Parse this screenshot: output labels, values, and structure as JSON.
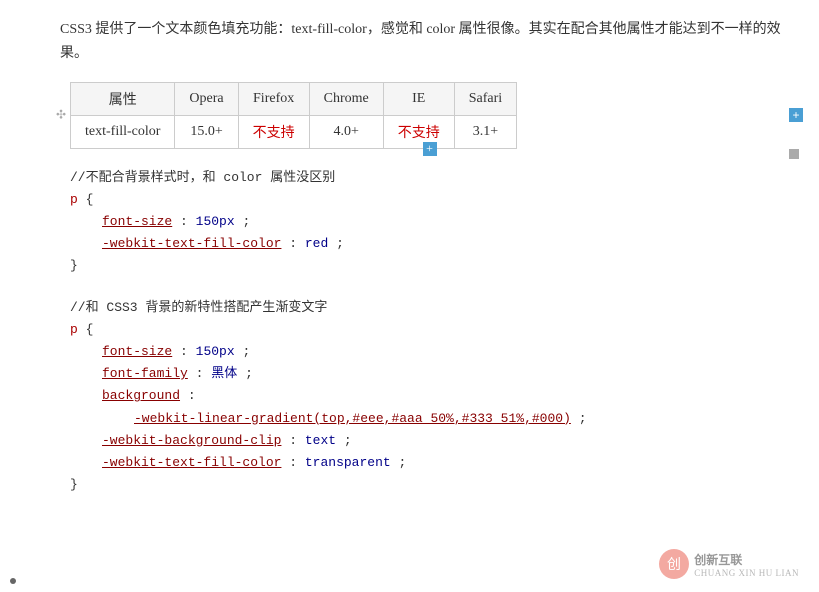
{
  "intro": {
    "text": "CSS3 提供了一个文本颜色填充功能：text-fill-color，感觉和 color 属性很像。其实在配合其他属性才能达到不一样的效果。"
  },
  "table": {
    "headers": [
      "属性",
      "Opera",
      "Firefox",
      "Chrome",
      "IE",
      "Safari"
    ],
    "rows": [
      {
        "property": "text-fill-color",
        "opera": "15.0+",
        "firefox": "不支持",
        "chrome": "4.0+",
        "ie": "不支持",
        "safari": "3.1+"
      }
    ],
    "firefox_unsupported": "不支持",
    "ie_unsupported": "不支持"
  },
  "code_block_1": {
    "comment": "//不配合背景样式时，和 color 属性没区别",
    "selector": "p {",
    "lines": [
      "font-size:  150px;",
      "-webkit-text-fill-color: red;"
    ],
    "close": "}"
  },
  "code_block_2": {
    "comment": "//和 CSS3 背景的新特性搭配产生渐变文字",
    "selector": "p {",
    "lines": [
      "font-size:  150px;",
      "font-family: 黑体;",
      "background:",
      "    -webkit-linear-gradient(top,#eee,#aaa 50%,#333 51%,#000);",
      "-webkit-background-clip:text;",
      "-webkit-text-fill-color: transparent;"
    ],
    "close": "}"
  },
  "watermark": {
    "logo_text": "创",
    "text": "创新互联",
    "subtext": "CHUANG XIN HU LIAN"
  },
  "icons": {
    "move": "✣",
    "plus": "+",
    "resize": "◢"
  }
}
